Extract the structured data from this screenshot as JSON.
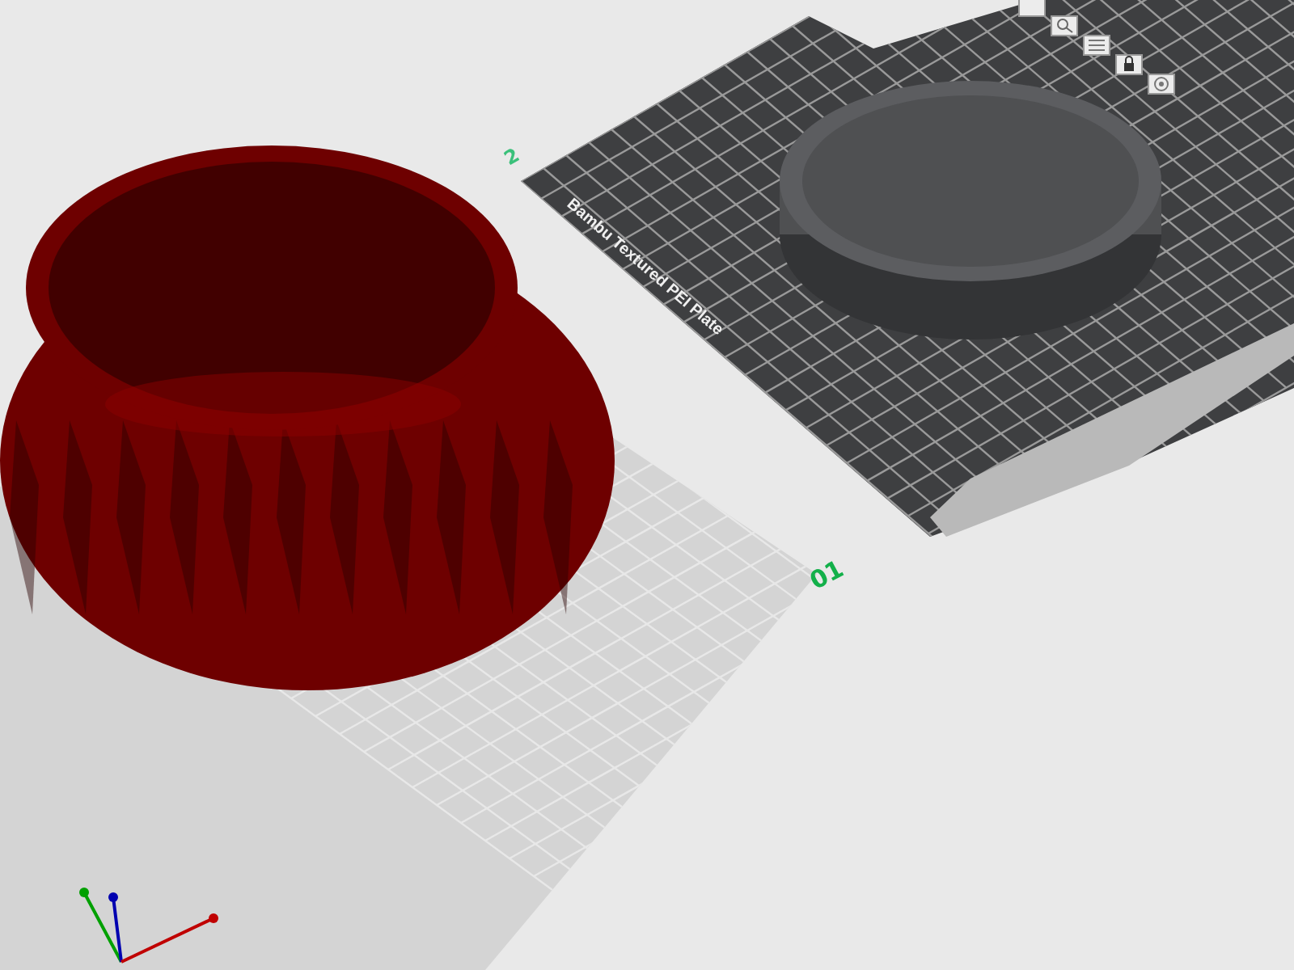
{
  "viewport": {
    "plates": [
      {
        "kind": "plain",
        "label": "01"
      },
      {
        "kind": "textured",
        "label": "2",
        "bed_text": "Bambu Textured PEI Plate"
      }
    ],
    "objects": [
      {
        "kind": "vase",
        "color": "#6e0000"
      },
      {
        "kind": "ring",
        "color": "#4f5052"
      }
    ]
  }
}
